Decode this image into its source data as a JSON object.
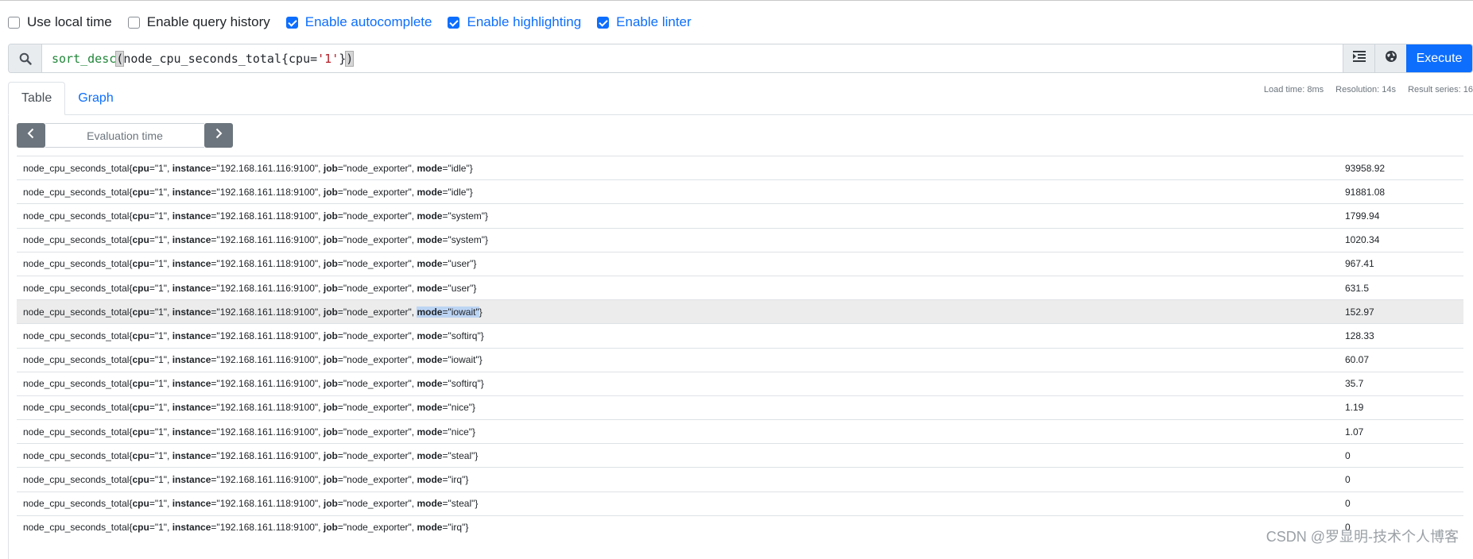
{
  "options": [
    {
      "label": "Use local time",
      "checked": false
    },
    {
      "label": "Enable query history",
      "checked": false
    },
    {
      "label": "Enable autocomplete",
      "checked": true
    },
    {
      "label": "Enable highlighting",
      "checked": true
    },
    {
      "label": "Enable linter",
      "checked": true
    }
  ],
  "query": {
    "fn": "sort_desc",
    "open": "(",
    "metric": "node_cpu_seconds_total{cpu=",
    "str": "'1'",
    "close_brace": "}",
    "close": ")",
    "execute_label": "Execute"
  },
  "tabs": {
    "table": "Table",
    "graph": "Graph"
  },
  "stats": {
    "load": "Load time: 8ms",
    "resolution": "Resolution: 14s",
    "series": "Result series: 16"
  },
  "eval_placeholder": "Evaluation time",
  "rows": [
    {
      "metric": "node_cpu_seconds_total",
      "cpu": "1",
      "instance": "192.168.161.116:9100",
      "job": "node_exporter",
      "mode": "idle",
      "value": "93958.92"
    },
    {
      "metric": "node_cpu_seconds_total",
      "cpu": "1",
      "instance": "192.168.161.118:9100",
      "job": "node_exporter",
      "mode": "idle",
      "value": "91881.08"
    },
    {
      "metric": "node_cpu_seconds_total",
      "cpu": "1",
      "instance": "192.168.161.118:9100",
      "job": "node_exporter",
      "mode": "system",
      "value": "1799.94"
    },
    {
      "metric": "node_cpu_seconds_total",
      "cpu": "1",
      "instance": "192.168.161.116:9100",
      "job": "node_exporter",
      "mode": "system",
      "value": "1020.34"
    },
    {
      "metric": "node_cpu_seconds_total",
      "cpu": "1",
      "instance": "192.168.161.118:9100",
      "job": "node_exporter",
      "mode": "user",
      "value": "967.41"
    },
    {
      "metric": "node_cpu_seconds_total",
      "cpu": "1",
      "instance": "192.168.161.116:9100",
      "job": "node_exporter",
      "mode": "user",
      "value": "631.5"
    },
    {
      "metric": "node_cpu_seconds_total",
      "cpu": "1",
      "instance": "192.168.161.118:9100",
      "job": "node_exporter",
      "mode": "iowait",
      "value": "152.97"
    },
    {
      "metric": "node_cpu_seconds_total",
      "cpu": "1",
      "instance": "192.168.161.118:9100",
      "job": "node_exporter",
      "mode": "softirq",
      "value": "128.33"
    },
    {
      "metric": "node_cpu_seconds_total",
      "cpu": "1",
      "instance": "192.168.161.116:9100",
      "job": "node_exporter",
      "mode": "iowait",
      "value": "60.07"
    },
    {
      "metric": "node_cpu_seconds_total",
      "cpu": "1",
      "instance": "192.168.161.116:9100",
      "job": "node_exporter",
      "mode": "softirq",
      "value": "35.7"
    },
    {
      "metric": "node_cpu_seconds_total",
      "cpu": "1",
      "instance": "192.168.161.118:9100",
      "job": "node_exporter",
      "mode": "nice",
      "value": "1.19"
    },
    {
      "metric": "node_cpu_seconds_total",
      "cpu": "1",
      "instance": "192.168.161.116:9100",
      "job": "node_exporter",
      "mode": "nice",
      "value": "1.07"
    },
    {
      "metric": "node_cpu_seconds_total",
      "cpu": "1",
      "instance": "192.168.161.116:9100",
      "job": "node_exporter",
      "mode": "steal",
      "value": "0"
    },
    {
      "metric": "node_cpu_seconds_total",
      "cpu": "1",
      "instance": "192.168.161.116:9100",
      "job": "node_exporter",
      "mode": "irq",
      "value": "0"
    },
    {
      "metric": "node_cpu_seconds_total",
      "cpu": "1",
      "instance": "192.168.161.118:9100",
      "job": "node_exporter",
      "mode": "steal",
      "value": "0"
    },
    {
      "metric": "node_cpu_seconds_total",
      "cpu": "1",
      "instance": "192.168.161.118:9100",
      "job": "node_exporter",
      "mode": "irq",
      "value": "0"
    }
  ],
  "highlighted_row": 6,
  "watermark": "CSDN @罗显明-技术个人博客",
  "colors": {
    "primary": "#0d6efd",
    "secondary": "#6c757d"
  },
  "icons": {
    "search": "search-icon",
    "format": "format-indent-icon",
    "explorer": "globe-icon",
    "prev": "chevron-left-icon",
    "next": "chevron-right-icon"
  }
}
